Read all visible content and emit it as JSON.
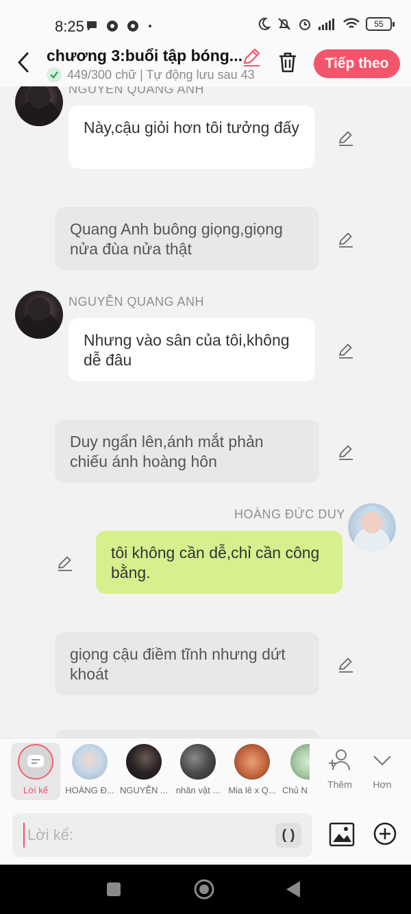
{
  "status": {
    "time": "8:25",
    "battery": "55"
  },
  "header": {
    "title": "chương 3:buổi tập bóng...",
    "subtitle": "449/300 chữ | Tự động lưu sau 43",
    "next_label": "Tiếp theo"
  },
  "messages": [
    {
      "type": "character",
      "side": "left",
      "name": "NGUYỄN QUANG ANH",
      "text": "Này,cậu giỏi hơn tôi tưởng đấy"
    },
    {
      "type": "narration",
      "text": "Quang Anh buông giọng,giọng nửa đùa nửa thật"
    },
    {
      "type": "character",
      "side": "left",
      "name": "NGUYỄN QUANG ANH",
      "text": "Nhưng vào sân của tôi,không dễ đâu"
    },
    {
      "type": "narration",
      "text": "Duy ngẩn lên,ánh mắt phản chiếu ánh hoàng hôn"
    },
    {
      "type": "character",
      "side": "right",
      "name": "HOÀNG ĐỨC DUY",
      "text": "tôi không cần dễ,chỉ cần công bằng."
    },
    {
      "type": "narration",
      "text": "giọng cậu điềm tĩnh nhưng dứt khoát"
    }
  ],
  "characters": [
    {
      "label": "Lời kể",
      "active": true
    },
    {
      "label": "HOÀNG Đ..."
    },
    {
      "label": "NGUYỄN ..."
    },
    {
      "label": "nhân vật ..."
    },
    {
      "label": "Mia lê x Q..."
    },
    {
      "label": "Chủ N"
    }
  ],
  "tab_actions": {
    "add_label": "Thêm",
    "more_label": "Hơn"
  },
  "composer": {
    "placeholder": "Lời kể:",
    "paren_label": "( )"
  }
}
